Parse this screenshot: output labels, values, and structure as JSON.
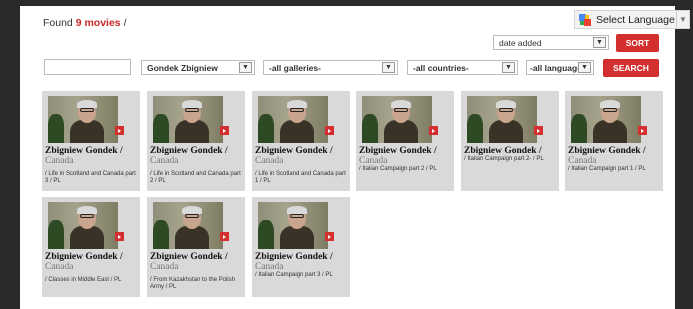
{
  "header": {
    "found_prefix": "Found ",
    "found_count": "9 movies",
    "found_suffix": " /"
  },
  "language": {
    "label": "Select Language"
  },
  "sort": {
    "selected": "date added",
    "button": "SORT"
  },
  "filters": {
    "search_value": "",
    "person": "Gondek Zbigniew",
    "galleries": "-all galleries-",
    "countries": "-all countries-",
    "languages": "-all languages-",
    "search_button": "SEARCH"
  },
  "movies": [
    {
      "name": "Zbigniew Gondek /",
      "country": "Canada",
      "title": "/ Life in Scotland and Canada part 3 / PL"
    },
    {
      "name": "Zbigniew Gondek /",
      "country": "Canada",
      "title": "/ Life in Scotland and Canada part 2 / PL"
    },
    {
      "name": "Zbigniew Gondek /",
      "country": "Canada",
      "title": "/ Life in Scotland and Canada part 1 / PL"
    },
    {
      "name": "Zbigniew Gondek /",
      "country": "Canada",
      "title": "/ Italian Campaign part 2 / PL"
    },
    {
      "name": "Zbigniew Gondek /",
      "country": "",
      "title": "/ Italian Campaign part 2- / PL"
    },
    {
      "name": "Zbigniew Gondek /",
      "country": "Canada",
      "title": "/ Italian Campaign part 1 / PL"
    },
    {
      "name": "Zbigniew Gondek /",
      "country": "Canada",
      "title": "/ Classes in Middle East / PL"
    },
    {
      "name": "Zbigniew Gondek /",
      "country": "Canada",
      "title": "/ From Kazakhstan to the Polish Army / PL"
    },
    {
      "name": "Zbigniew Gondek /",
      "country": "Canada",
      "title": "/ Italian Campaign part 3 / PL"
    }
  ]
}
